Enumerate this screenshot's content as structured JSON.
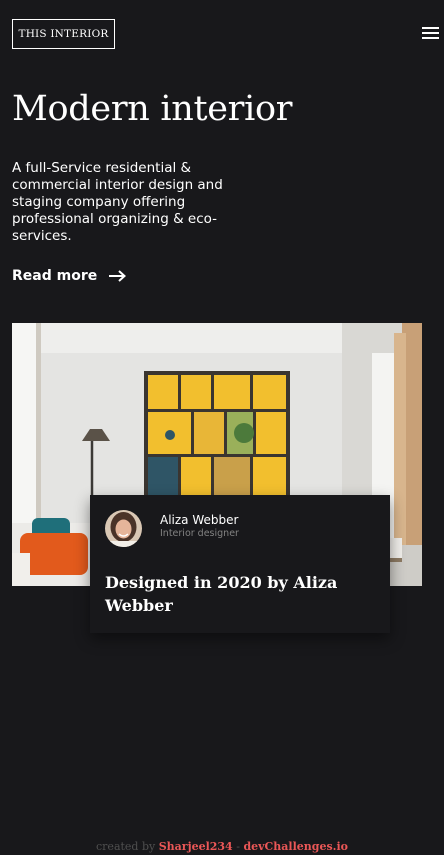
{
  "header": {
    "logo_text": "THIS INTERIOR"
  },
  "hero": {
    "title": "Modern interior",
    "description": "A full-Service residential & commercial interior design and staging company offering professional organizing & eco-services.",
    "read_more_label": "Read more"
  },
  "card": {
    "author_name": "Aliza Webber",
    "author_role": "Interior designer",
    "title": "Designed in 2020 by Aliza Webber"
  },
  "footer": {
    "prefix": "created by",
    "author": "Sharjeel234",
    "separator": "-",
    "site": "devChallenges.io"
  },
  "colors": {
    "background": "#18181b",
    "text": "#ffffff",
    "muted": "#828282",
    "accent": "#eb5757"
  },
  "icons": {
    "menu": "hamburger-icon",
    "read_more": "arrow-right-icon"
  }
}
